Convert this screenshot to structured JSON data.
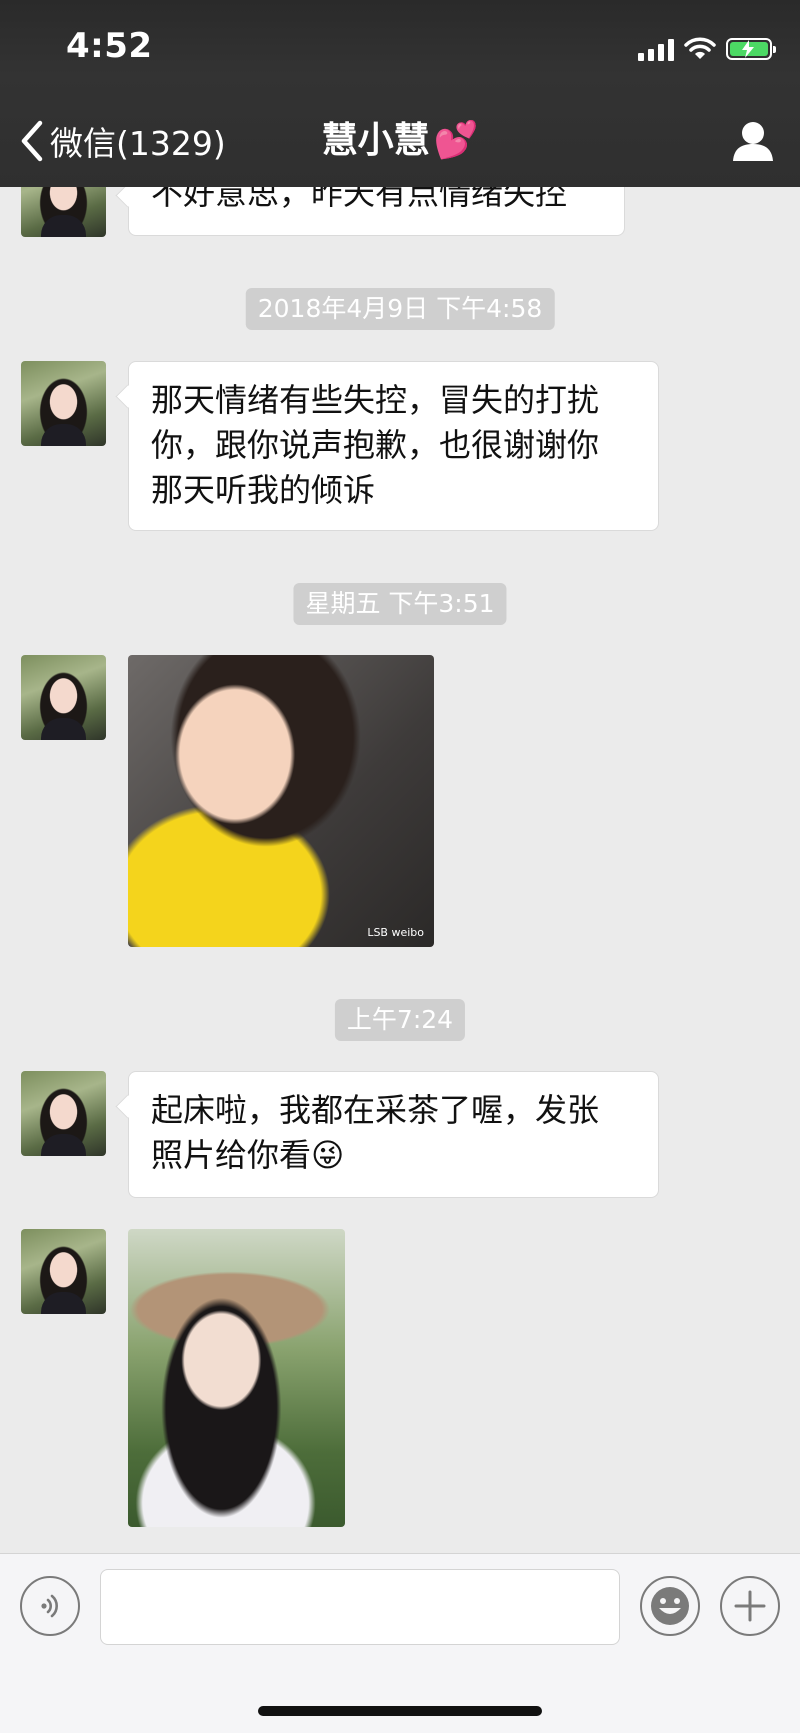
{
  "status_bar": {
    "time": "4:52"
  },
  "nav": {
    "back_label": "微信(1329)",
    "title": "慧小慧",
    "title_emoji": "💕"
  },
  "chat": {
    "messages": [
      {
        "type": "text",
        "text_lines": [
          "不好意思，昨天有点情绪失控"
        ]
      },
      {
        "type": "timestamp",
        "text": "2018年4月9日 下午4:58"
      },
      {
        "type": "text",
        "text_lines": [
          "那天情绪有些失控，冒失的打扰",
          "你，跟你说声抱歉，也很谢谢你",
          "那天听我的倾诉"
        ]
      },
      {
        "type": "timestamp",
        "text": "星期五 下午3:51"
      },
      {
        "type": "image",
        "watermark": "LSB weibo"
      },
      {
        "type": "timestamp",
        "text": "上午7:24"
      },
      {
        "type": "text",
        "text_lines": [
          "起床啦，我都在采茶了喔，发张",
          "照片给你看"
        ],
        "emoji": "😜"
      },
      {
        "type": "image"
      }
    ]
  },
  "input": {
    "value": "",
    "placeholder": ""
  },
  "icons": {
    "back": "chevron-left-icon",
    "contact": "person-icon",
    "voice": "voice-icon",
    "emoji": "smiley-icon",
    "plus": "plus-icon"
  },
  "colors": {
    "topbar": "#333333",
    "background": "#ebebeb",
    "battery": "#4cd964",
    "timestamp_bg": "#cfcfcf"
  }
}
